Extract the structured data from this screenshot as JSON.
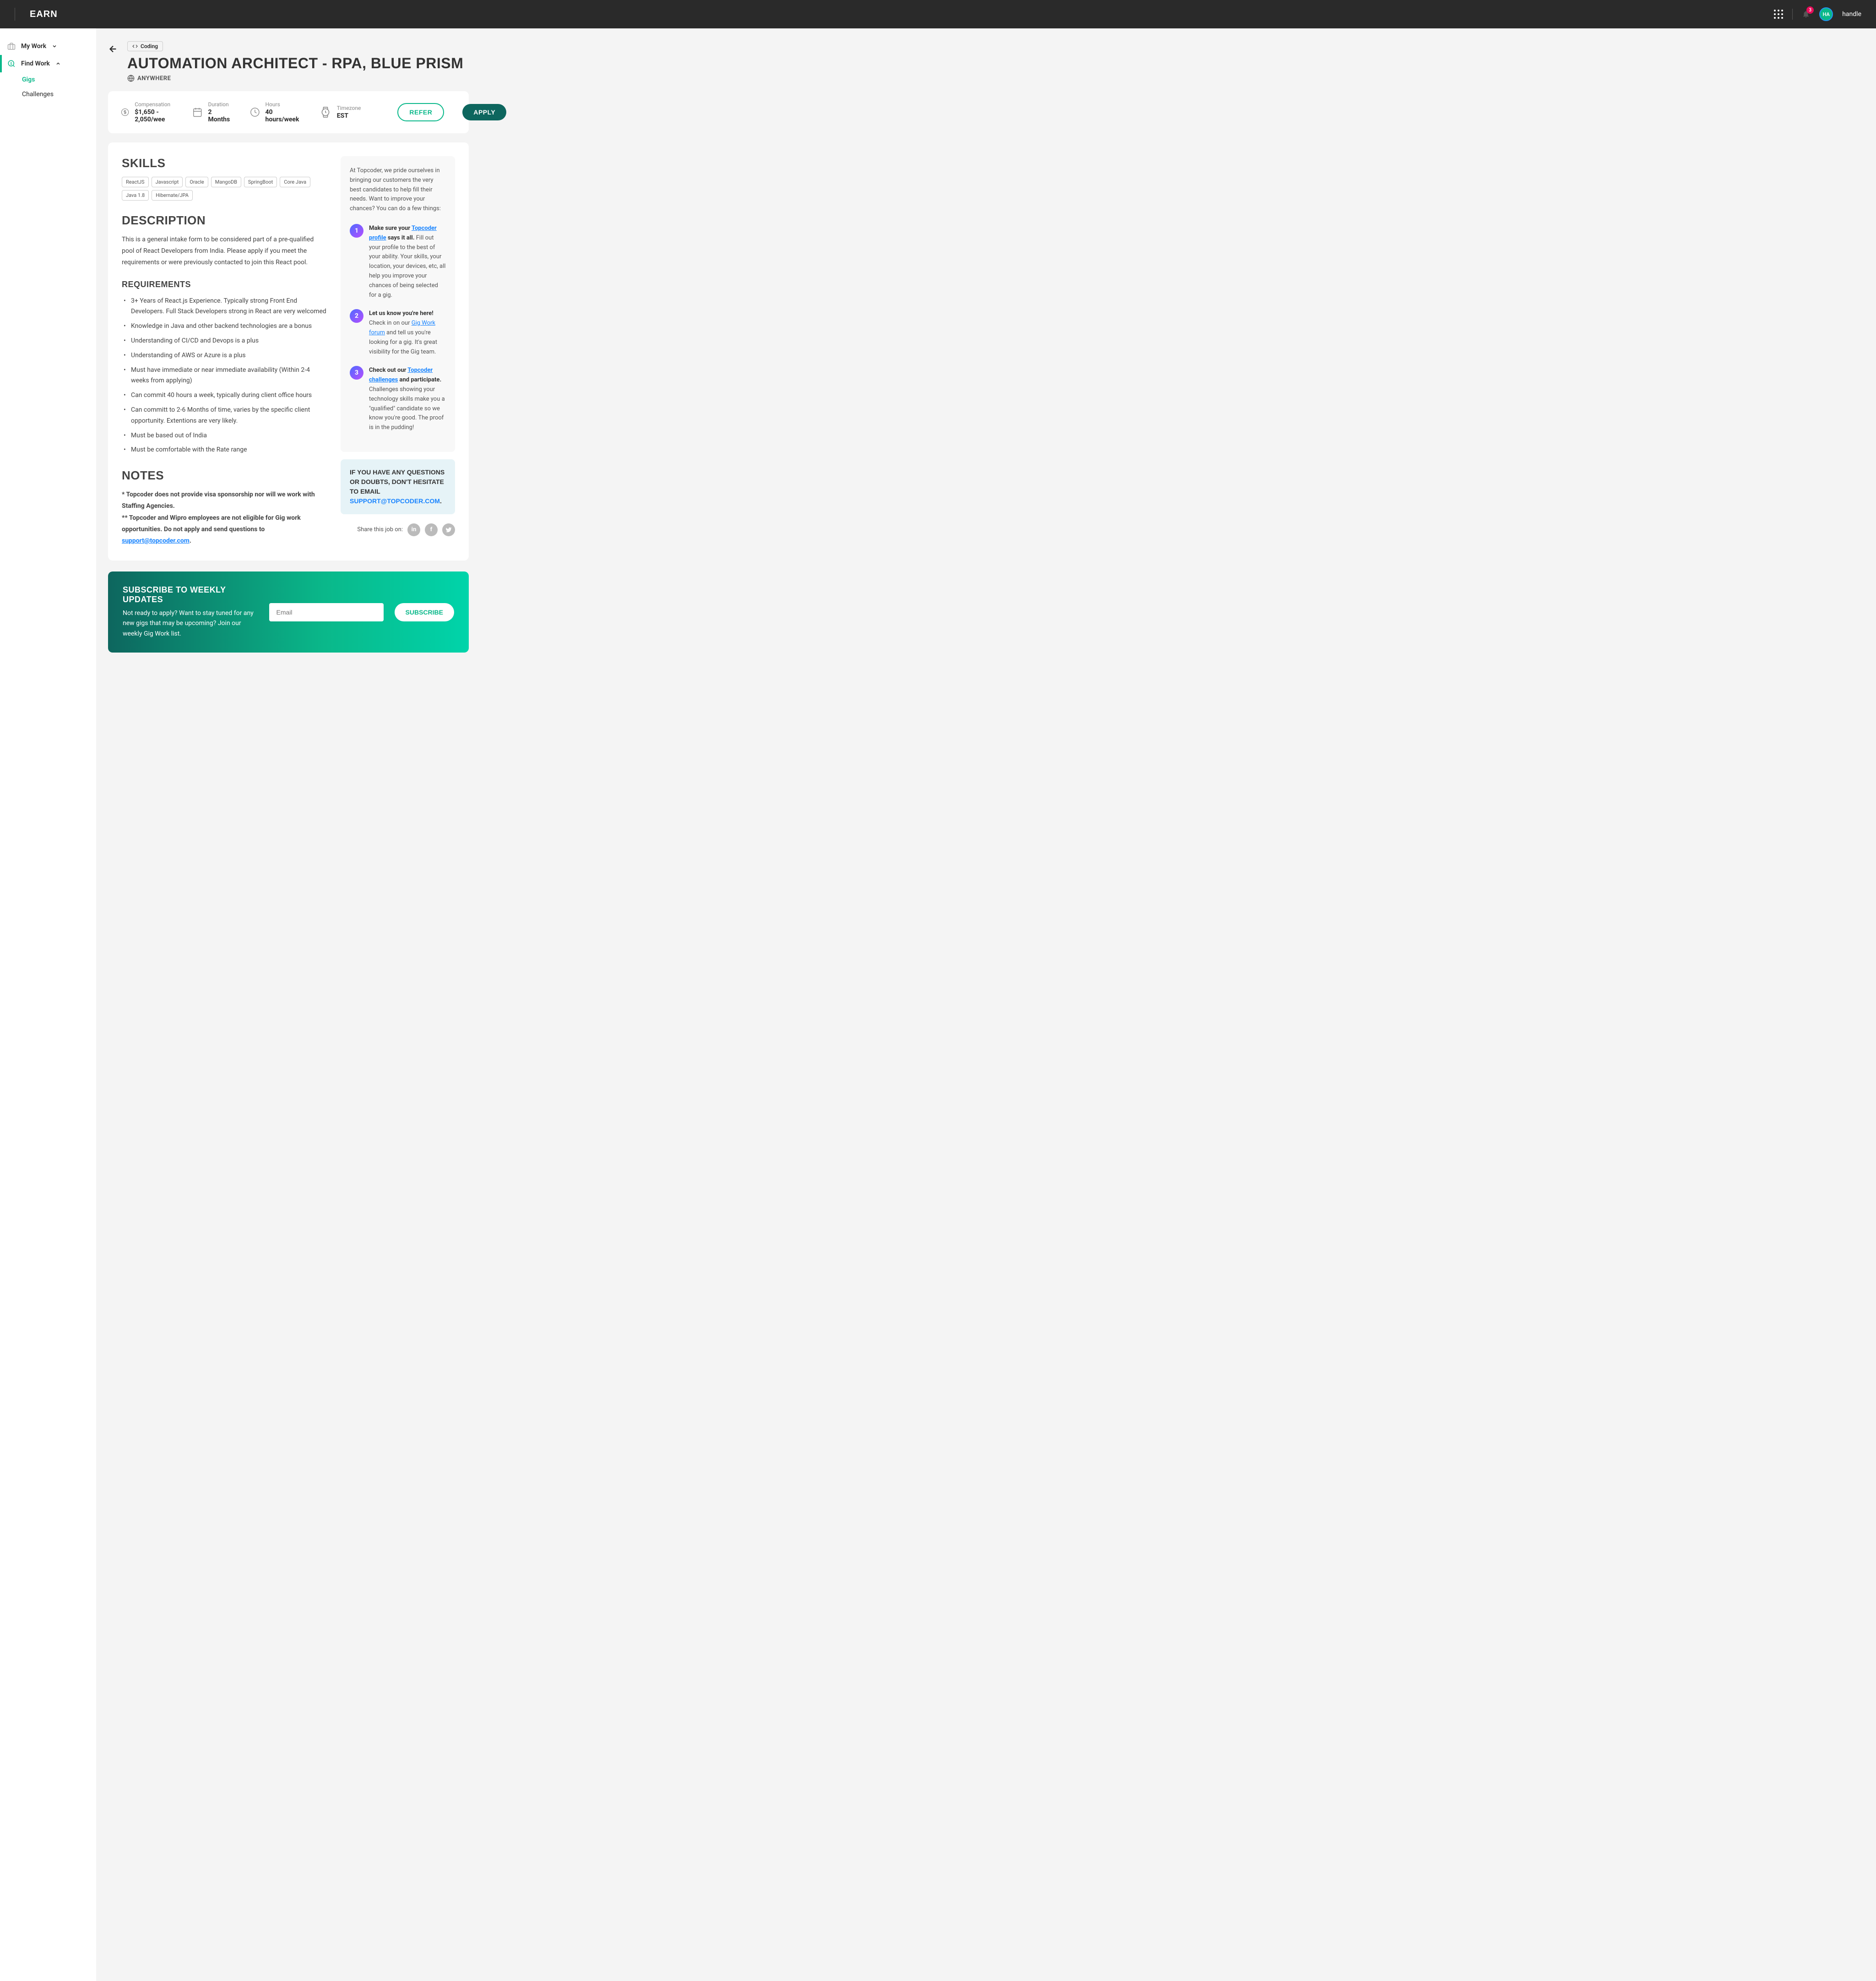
{
  "header": {
    "brand": "EARN",
    "badge": "3",
    "avatar": "HA",
    "handle": "handle"
  },
  "sidebar": {
    "myWork": "My Work",
    "findWork": "Find Work",
    "gigs": "Gigs",
    "challenges": "Challenges"
  },
  "title": {
    "category": "Coding",
    "heading": "AUTOMATION ARCHITECT - RPA, BLUE PRISM",
    "location": "ANYWHERE"
  },
  "info": {
    "compensation": {
      "label": "Compensation",
      "value": "$1,650 - 2,050/wee"
    },
    "duration": {
      "label": "Duration",
      "value": "2 Months"
    },
    "hours": {
      "label": "Hours",
      "value": "40 hours/week"
    },
    "timezone": {
      "label": "Timezone",
      "value": "EST"
    },
    "refer": "REFER",
    "apply": "APPLY"
  },
  "skills": {
    "heading": "SKILLS",
    "tags": [
      "ReactJS",
      "Javascript",
      "Oracle",
      "MangoDB",
      "SpringBoot",
      "Core Java",
      "Java 1.8",
      "Hibernate/JPA"
    ]
  },
  "description": {
    "heading": "DESCRIPTION",
    "text": "This is a general intake form to be considered part of a pre-qualified pool of React Developers from India.  Please apply if you meet the requirements or were previously contacted to join this React pool."
  },
  "requirements": {
    "heading": "REQUIREMENTS",
    "items": [
      "3+ Years of React.js Experience.  Typically strong Front End Developers.  Full Stack Developers strong in React are very welcomed",
      "Knowledge in Java and other backend technologies are a bonus",
      "Understanding of CI/CD and Devops is a plus",
      "Understanding of AWS or Azure is a plus",
      "Must have immediate or near immediate availability (Within 2-4 weeks from applying)",
      "Can commit 40 hours a week, typically during client office hours",
      "Can committ to 2-6 Months of time, varies by the specific client opportunity.  Extentions are very likely.",
      "Must be based out of India",
      "Must be comfortable with the Rate range"
    ]
  },
  "notes": {
    "heading": "NOTES",
    "line1": "* Topcoder does not provide visa sponsorship nor will we work with Staffing Agencies.",
    "line2a": "** Topcoder and Wipro employees are not eligible for Gig work opportunities. Do not apply and send questions to ",
    "line2link": "support@topcoder.com",
    "line2b": "."
  },
  "tips": {
    "intro": "At Topcoder, we pride ourselves in bringing our customers the very best candidates to help fill their needs. Want to improve your chances? You can do a few things:",
    "items": [
      {
        "num": "1",
        "boldA": "Make sure your ",
        "link": "Topcoder profile",
        "boldB": " says it all.",
        "rest": " Fill out your profile to the best of your ability. Your skills, your location, your devices, etc, all help you improve your chances of being selected for a gig."
      },
      {
        "num": "2",
        "boldA": "Let us know you're here!",
        "restA": " Check in on our ",
        "link": "Gig Work forum",
        "restB": " and tell us you're looking for a gig. It's great visibility for the Gig team."
      },
      {
        "num": "3",
        "boldA": "Check out our ",
        "link": "Topcoder challenges",
        "boldB": " and participate.",
        "rest": " Challenges showing your technology skills make you a \"qualified\" candidate so we know you're good. The proof is in the pudding!"
      }
    ]
  },
  "contact": {
    "text": "IF YOU HAVE ANY QUESTIONS OR DOUBTS, DON'T HESITATE  TO EMAIL ",
    "email": "SUPPORT@TOPCODER.COM",
    "dot": "."
  },
  "share": {
    "label": "Share this job on:"
  },
  "subscribe": {
    "title": "SUBSCRIBE TO WEEKLY UPDATES",
    "desc": "Not ready to apply? Want to stay tuned for any new gigs that may be upcoming? Join our weekly Gig Work list.",
    "placeholder": "Email",
    "button": "SUBSCRIBE"
  }
}
